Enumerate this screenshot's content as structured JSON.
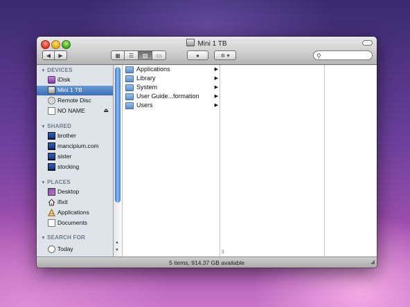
{
  "window": {
    "title": "Mini 1 TB"
  },
  "toolbar": {
    "back_icon": "◀",
    "forward_icon": "▶",
    "view_icons": [
      "▦",
      "☰",
      "▥",
      "▭"
    ],
    "eye_icon": "●",
    "gear_icon": "✲ ▾",
    "search_placeholder": ""
  },
  "sidebar": {
    "sections": [
      {
        "label": "DEVICES",
        "items": [
          {
            "label": "iDisk",
            "icon": "idisk-icon"
          },
          {
            "label": "Mini 1 TB",
            "icon": "hard-disk-icon",
            "selected": true
          },
          {
            "label": "Remote Disc",
            "icon": "remote-disc-icon"
          },
          {
            "label": "NO NAME",
            "icon": "volume-icon",
            "eject": "⏏"
          }
        ]
      },
      {
        "label": "SHARED",
        "items": [
          {
            "label": "brother",
            "icon": "computer-icon"
          },
          {
            "label": "mancipium.com",
            "icon": "computer-icon"
          },
          {
            "label": "sister",
            "icon": "computer-icon"
          },
          {
            "label": "stocking",
            "icon": "computer-icon"
          }
        ]
      },
      {
        "label": "PLACES",
        "items": [
          {
            "label": "Desktop",
            "icon": "desktop-icon"
          },
          {
            "label": "ifixit",
            "icon": "home-icon"
          },
          {
            "label": "Applications",
            "icon": "applications-icon"
          },
          {
            "label": "Documents",
            "icon": "documents-icon"
          }
        ]
      },
      {
        "label": "SEARCH FOR",
        "items": [
          {
            "label": "Today",
            "icon": "clock-icon"
          }
        ]
      }
    ]
  },
  "column1": {
    "items": [
      {
        "label": "Applications"
      },
      {
        "label": "Library"
      },
      {
        "label": "System"
      },
      {
        "label": "User Guide...formation"
      },
      {
        "label": "Users"
      }
    ]
  },
  "status": {
    "text": "5 items, 914.37 GB available"
  }
}
